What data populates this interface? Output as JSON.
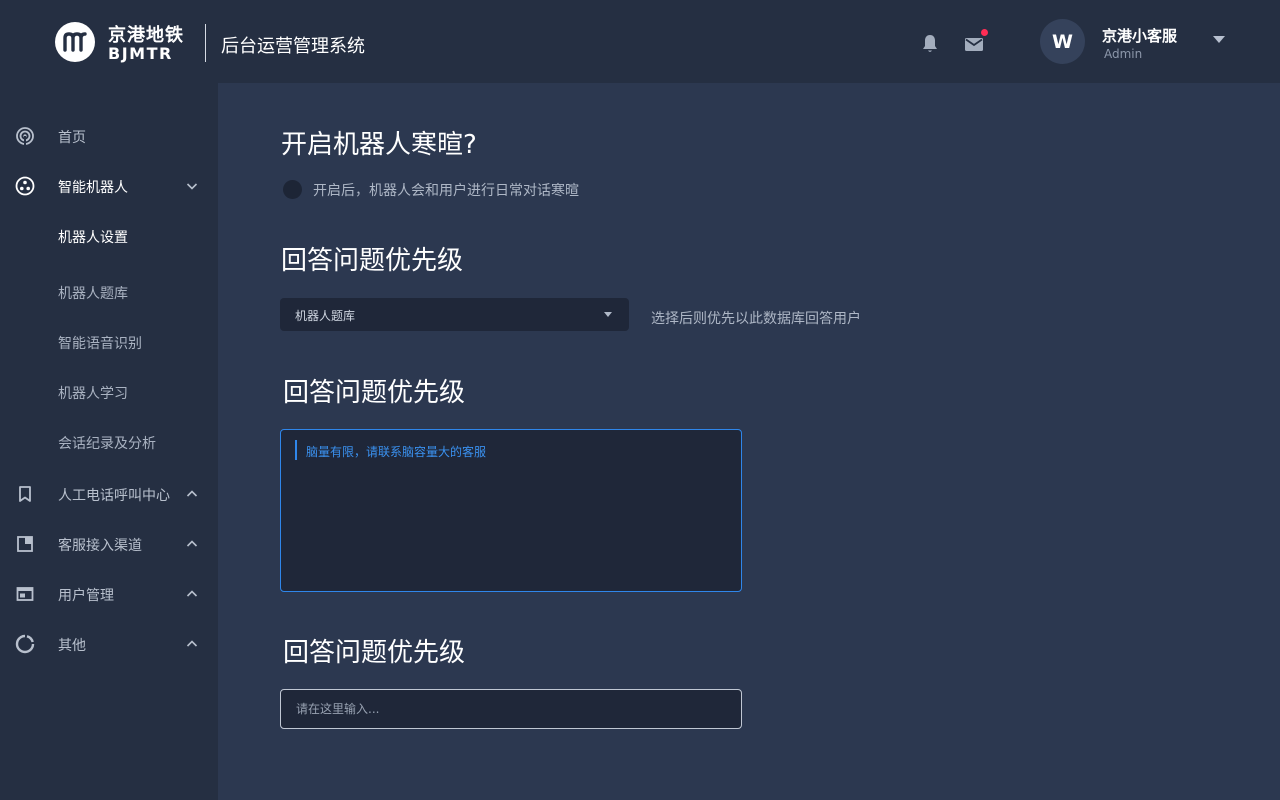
{
  "header": {
    "logo_cn": "京港地铁",
    "logo_en": "BJMTR",
    "system_title": "后台运营管理系统",
    "bell_icon": "bell-icon",
    "mail_icon": "mail-icon",
    "mail_has_notification": true,
    "user": {
      "avatar_letter": "W",
      "name": "京港小客服",
      "role": "Admin"
    }
  },
  "sidebar": {
    "items": [
      {
        "label": "首页",
        "icon": "home-signal-icon",
        "expanded": null
      },
      {
        "label": "智能机器人",
        "icon": "robot-icon",
        "expanded": true,
        "children": [
          {
            "label": "机器人设置",
            "active": true
          },
          {
            "label": "机器人题库",
            "active": false
          },
          {
            "label": "智能语音识别",
            "active": false
          },
          {
            "label": "机器人学习",
            "active": false
          },
          {
            "label": "会话纪录及分析",
            "active": false
          }
        ]
      },
      {
        "label": "人工电话呼叫中心",
        "icon": "bookmark-icon",
        "expanded": false
      },
      {
        "label": "客服接入渠道",
        "icon": "window-icon",
        "expanded": false
      },
      {
        "label": "用户管理",
        "icon": "user-card-icon",
        "expanded": false
      },
      {
        "label": "其他",
        "icon": "pie-chart-icon",
        "expanded": false
      }
    ]
  },
  "main": {
    "greeting": {
      "title": "开启机器人寒暄?",
      "toggle_description": "开启后，机器人会和用户进行日常对话寒暄",
      "enabled": false
    },
    "priority_select": {
      "title": "回答问题优先级",
      "selected_value": "机器人题库",
      "hint": "选择后则优先以此数据库回答用户"
    },
    "priority_textarea": {
      "title": "回答问题优先级",
      "value": "脑量有限，请联系脑容量大的客服"
    },
    "priority_input": {
      "title": "回答问题优先级",
      "placeholder": "请在这里输入..."
    }
  },
  "colors": {
    "header_bg": "#252f42",
    "sidebar_bg": "#252f42",
    "main_bg": "#2c3850",
    "field_bg": "#1f2739",
    "accent_blue": "#2f86ea",
    "notification_red": "#ff2d55"
  }
}
